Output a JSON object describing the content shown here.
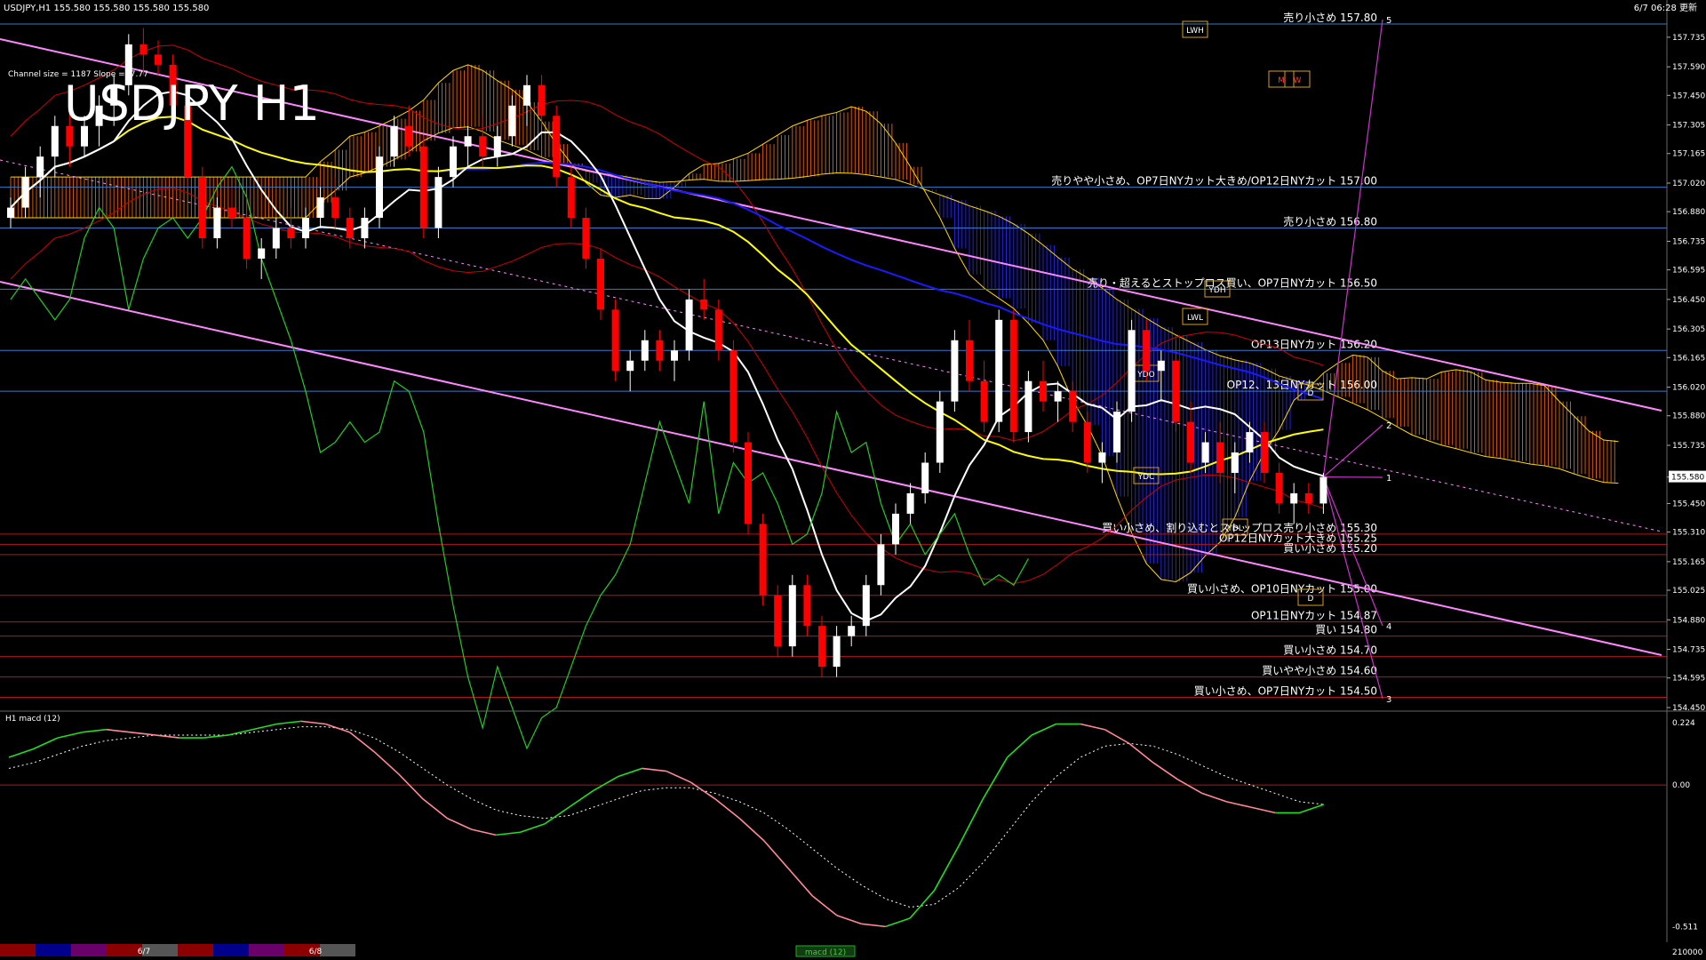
{
  "header": {
    "symbol_line": "USDJPY,H1  155.580 155.580 155.580 155.580",
    "channel_info": "Channel size = 1187 Slope = -7.77",
    "big_title": "USDJPY H1",
    "timestamp": "6/7 06:28 更新"
  },
  "colors": {
    "background": "#000000",
    "bull_candle": "#ffffff",
    "bear_candle": "#ff0000",
    "ma_white": "#ffffff",
    "ma_yellow": "#ffff00",
    "ma_blue": "#1a1aff",
    "kumo_blue": "#2a2aff",
    "kumo_orange": "#ff6a00",
    "chikou_green": "#22cc22",
    "bollinger_red": "#cc0000",
    "channel_pink": "#ff88ff",
    "level_blue": "#3a78c8",
    "level_red": "#b01818",
    "macd_green": "#22dd22",
    "macd_pink": "#ff8899",
    "projection_magenta": "#cc33cc"
  },
  "chart_data": {
    "type": "candlestick",
    "ylim": [
      154.45,
      157.9
    ],
    "yticks": [
      "157.735",
      "157.590",
      "157.450",
      "157.305",
      "157.165",
      "157.020",
      "156.880",
      "156.735",
      "156.595",
      "156.450",
      "156.305",
      "156.165",
      "156.020",
      "155.880",
      "155.735",
      "155.580",
      "155.450",
      "155.310",
      "155.165",
      "155.025",
      "154.880",
      "154.735",
      "154.595",
      "154.450"
    ],
    "current_price": "155.580",
    "candles": [
      [
        156.85,
        156.95,
        156.8,
        156.9
      ],
      [
        156.9,
        157.1,
        156.85,
        157.05
      ],
      [
        157.05,
        157.2,
        156.95,
        157.15
      ],
      [
        157.15,
        157.35,
        157.05,
        157.3
      ],
      [
        157.3,
        157.4,
        157.1,
        157.2
      ],
      [
        157.2,
        157.35,
        157.15,
        157.3
      ],
      [
        157.3,
        157.45,
        157.2,
        157.4
      ],
      [
        157.4,
        157.55,
        157.3,
        157.5
      ],
      [
        157.5,
        157.75,
        157.45,
        157.7
      ],
      [
        157.7,
        157.78,
        157.55,
        157.65
      ],
      [
        157.65,
        157.72,
        157.55,
        157.6
      ],
      [
        157.6,
        157.65,
        157.35,
        157.4
      ],
      [
        157.4,
        157.45,
        157.0,
        157.05
      ],
      [
        157.05,
        157.1,
        156.7,
        156.75
      ],
      [
        156.75,
        156.95,
        156.7,
        156.9
      ],
      [
        156.9,
        157.0,
        156.8,
        156.85
      ],
      [
        156.85,
        156.95,
        156.6,
        156.65
      ],
      [
        156.65,
        156.75,
        156.55,
        156.7
      ],
      [
        156.7,
        156.85,
        156.65,
        156.8
      ],
      [
        156.8,
        156.9,
        156.7,
        156.75
      ],
      [
        156.75,
        156.9,
        156.7,
        156.85
      ],
      [
        156.85,
        157.0,
        156.8,
        156.95
      ],
      [
        156.95,
        157.05,
        156.8,
        156.85
      ],
      [
        156.85,
        156.9,
        156.7,
        156.75
      ],
      [
        156.75,
        156.9,
        156.7,
        156.85
      ],
      [
        156.85,
        157.2,
        156.8,
        157.15
      ],
      [
        157.15,
        157.35,
        157.1,
        157.3
      ],
      [
        157.3,
        157.4,
        157.15,
        157.2
      ],
      [
        157.2,
        157.25,
        156.75,
        156.8
      ],
      [
        156.8,
        157.1,
        156.75,
        157.05
      ],
      [
        157.05,
        157.25,
        157.0,
        157.2
      ],
      [
        157.2,
        157.3,
        157.1,
        157.25
      ],
      [
        157.25,
        157.35,
        157.1,
        157.15
      ],
      [
        157.15,
        157.3,
        157.1,
        157.25
      ],
      [
        157.25,
        157.45,
        157.2,
        157.4
      ],
      [
        157.4,
        157.55,
        157.3,
        157.5
      ],
      [
        157.5,
        157.55,
        157.3,
        157.35
      ],
      [
        157.35,
        157.4,
        157.0,
        157.05
      ],
      [
        157.05,
        157.1,
        156.8,
        156.85
      ],
      [
        156.85,
        156.9,
        156.6,
        156.65
      ],
      [
        156.65,
        156.7,
        156.35,
        156.4
      ],
      [
        156.4,
        156.45,
        156.05,
        156.1
      ],
      [
        156.1,
        156.2,
        156.0,
        156.15
      ],
      [
        156.15,
        156.3,
        156.1,
        156.25
      ],
      [
        156.25,
        156.3,
        156.1,
        156.15
      ],
      [
        156.15,
        156.25,
        156.05,
        156.2
      ],
      [
        156.2,
        156.5,
        156.15,
        156.45
      ],
      [
        156.45,
        156.55,
        156.35,
        156.4
      ],
      [
        156.4,
        156.45,
        156.15,
        156.2
      ],
      [
        156.2,
        156.25,
        155.7,
        155.75
      ],
      [
        155.75,
        155.8,
        155.3,
        155.35
      ],
      [
        155.35,
        155.4,
        154.95,
        155.0
      ],
      [
        155.0,
        155.05,
        154.7,
        154.75
      ],
      [
        154.75,
        155.1,
        154.7,
        155.05
      ],
      [
        155.05,
        155.1,
        154.8,
        154.85
      ],
      [
        154.85,
        154.9,
        154.6,
        154.65
      ],
      [
        154.65,
        154.85,
        154.6,
        154.8
      ],
      [
        154.8,
        154.9,
        154.75,
        154.85
      ],
      [
        154.85,
        155.1,
        154.8,
        155.05
      ],
      [
        155.05,
        155.3,
        155.0,
        155.25
      ],
      [
        155.25,
        155.45,
        155.2,
        155.4
      ],
      [
        155.4,
        155.55,
        155.35,
        155.5
      ],
      [
        155.5,
        155.7,
        155.45,
        155.65
      ],
      [
        155.65,
        156.0,
        155.6,
        155.95
      ],
      [
        155.95,
        156.3,
        155.9,
        156.25
      ],
      [
        156.25,
        156.35,
        156.0,
        156.05
      ],
      [
        156.05,
        156.15,
        155.8,
        155.85
      ],
      [
        155.85,
        156.4,
        155.8,
        156.35
      ],
      [
        156.35,
        156.4,
        155.75,
        155.8
      ],
      [
        155.8,
        156.1,
        155.75,
        156.05
      ],
      [
        156.05,
        156.15,
        155.9,
        155.95
      ],
      [
        155.95,
        156.05,
        155.85,
        156.0
      ],
      [
        156.0,
        156.05,
        155.8,
        155.85
      ],
      [
        155.85,
        155.9,
        155.6,
        155.65
      ],
      [
        155.65,
        155.75,
        155.55,
        155.7
      ],
      [
        155.7,
        155.95,
        155.65,
        155.9
      ],
      [
        155.9,
        156.35,
        155.85,
        156.3
      ],
      [
        156.3,
        156.35,
        156.05,
        156.1
      ],
      [
        156.1,
        156.2,
        155.95,
        156.15
      ],
      [
        156.15,
        156.25,
        155.8,
        155.85
      ],
      [
        155.85,
        155.95,
        155.6,
        155.65
      ],
      [
        155.65,
        155.8,
        155.6,
        155.75
      ],
      [
        155.75,
        155.85,
        155.55,
        155.6
      ],
      [
        155.6,
        155.75,
        155.5,
        155.7
      ],
      [
        155.7,
        155.85,
        155.65,
        155.8
      ],
      [
        155.8,
        155.85,
        155.55,
        155.6
      ],
      [
        155.6,
        155.65,
        155.4,
        155.45
      ],
      [
        155.45,
        155.55,
        155.35,
        155.5
      ],
      [
        155.5,
        155.55,
        155.4,
        155.45
      ],
      [
        155.45,
        155.6,
        155.4,
        155.58
      ]
    ],
    "levels": [
      {
        "price": 157.8,
        "label": "売り小さめ 157.80",
        "kind": "blue"
      },
      {
        "price": 157.0,
        "label": "売りやや小さめ、OP7日NYカット大きめ/OP12日NYカット 157.00",
        "kind": "blue"
      },
      {
        "price": 156.8,
        "label": "売り小さめ 156.80",
        "kind": "blue"
      },
      {
        "price": 156.5,
        "label": "売り・超えるとストップロス買い、OP7日NYカット 156.50",
        "kind": "blue"
      },
      {
        "price": 156.2,
        "label": "OP13日NYカット 156.20",
        "kind": "blue"
      },
      {
        "price": 156.0,
        "label": "OP12、13日NYカット 156.00",
        "kind": "blue"
      },
      {
        "price": 155.3,
        "label": "買い小さめ、割り込むとストップロス売り小さめ 155.30",
        "kind": "red"
      },
      {
        "price": 155.25,
        "label": "OP12日NYカット大きめ 155.25",
        "kind": "red"
      },
      {
        "price": 155.2,
        "label": "買い小さめ 155.20",
        "kind": "red"
      },
      {
        "price": 155.0,
        "label": "買い小さめ、OP10日NYカット 155.00",
        "kind": "red"
      },
      {
        "price": 154.87,
        "label": "OP11日NYカット 154.87",
        "kind": "red"
      },
      {
        "price": 154.8,
        "label": "買い 154.80",
        "kind": "red"
      },
      {
        "price": 154.7,
        "label": "買い小さめ 154.70",
        "kind": "red"
      },
      {
        "price": 154.6,
        "label": "買いやや小さめ 154.60",
        "kind": "red"
      },
      {
        "price": 154.5,
        "label": "買い小さめ、OP7日NYカット 154.50",
        "kind": "red"
      }
    ],
    "markers": [
      "LWH",
      "M",
      "W",
      "YDH",
      "LWL",
      "YDO",
      "D",
      "YDC",
      "YDL",
      "D"
    ],
    "projection_labels": [
      "5",
      "2",
      "1",
      "4",
      "3"
    ]
  },
  "macd": {
    "title": "H1  macd (12)",
    "yticks": [
      "0.224",
      "0.00",
      "-0.511"
    ],
    "ylim": [
      -0.56,
      0.26
    ],
    "main": [
      0.1,
      0.13,
      0.17,
      0.19,
      0.2,
      0.19,
      0.18,
      0.17,
      0.17,
      0.18,
      0.2,
      0.22,
      0.23,
      0.22,
      0.19,
      0.12,
      0.04,
      -0.05,
      -0.12,
      -0.16,
      -0.18,
      -0.17,
      -0.14,
      -0.08,
      -0.02,
      0.03,
      0.06,
      0.05,
      0.01,
      -0.05,
      -0.12,
      -0.2,
      -0.3,
      -0.4,
      -0.47,
      -0.5,
      -0.51,
      -0.48,
      -0.38,
      -0.22,
      -0.05,
      0.1,
      0.18,
      0.22,
      0.22,
      0.2,
      0.15,
      0.08,
      0.02,
      -0.03,
      -0.06,
      -0.08,
      -0.1,
      -0.1,
      -0.07
    ],
    "signal": [
      0.06,
      0.08,
      0.11,
      0.14,
      0.16,
      0.17,
      0.18,
      0.18,
      0.18,
      0.18,
      0.19,
      0.2,
      0.21,
      0.21,
      0.2,
      0.17,
      0.12,
      0.06,
      0.0,
      -0.05,
      -0.09,
      -0.11,
      -0.12,
      -0.11,
      -0.08,
      -0.05,
      -0.02,
      -0.01,
      -0.01,
      -0.03,
      -0.06,
      -0.1,
      -0.16,
      -0.23,
      -0.3,
      -0.36,
      -0.41,
      -0.44,
      -0.43,
      -0.37,
      -0.28,
      -0.17,
      -0.06,
      0.03,
      0.1,
      0.14,
      0.15,
      0.14,
      0.11,
      0.07,
      0.03,
      0.0,
      -0.03,
      -0.06,
      -0.07
    ]
  },
  "footer": {
    "date_labels": [
      "6/7",
      "6/8"
    ],
    "indicator_tab": "macd (12)",
    "volume_value": "210000"
  }
}
